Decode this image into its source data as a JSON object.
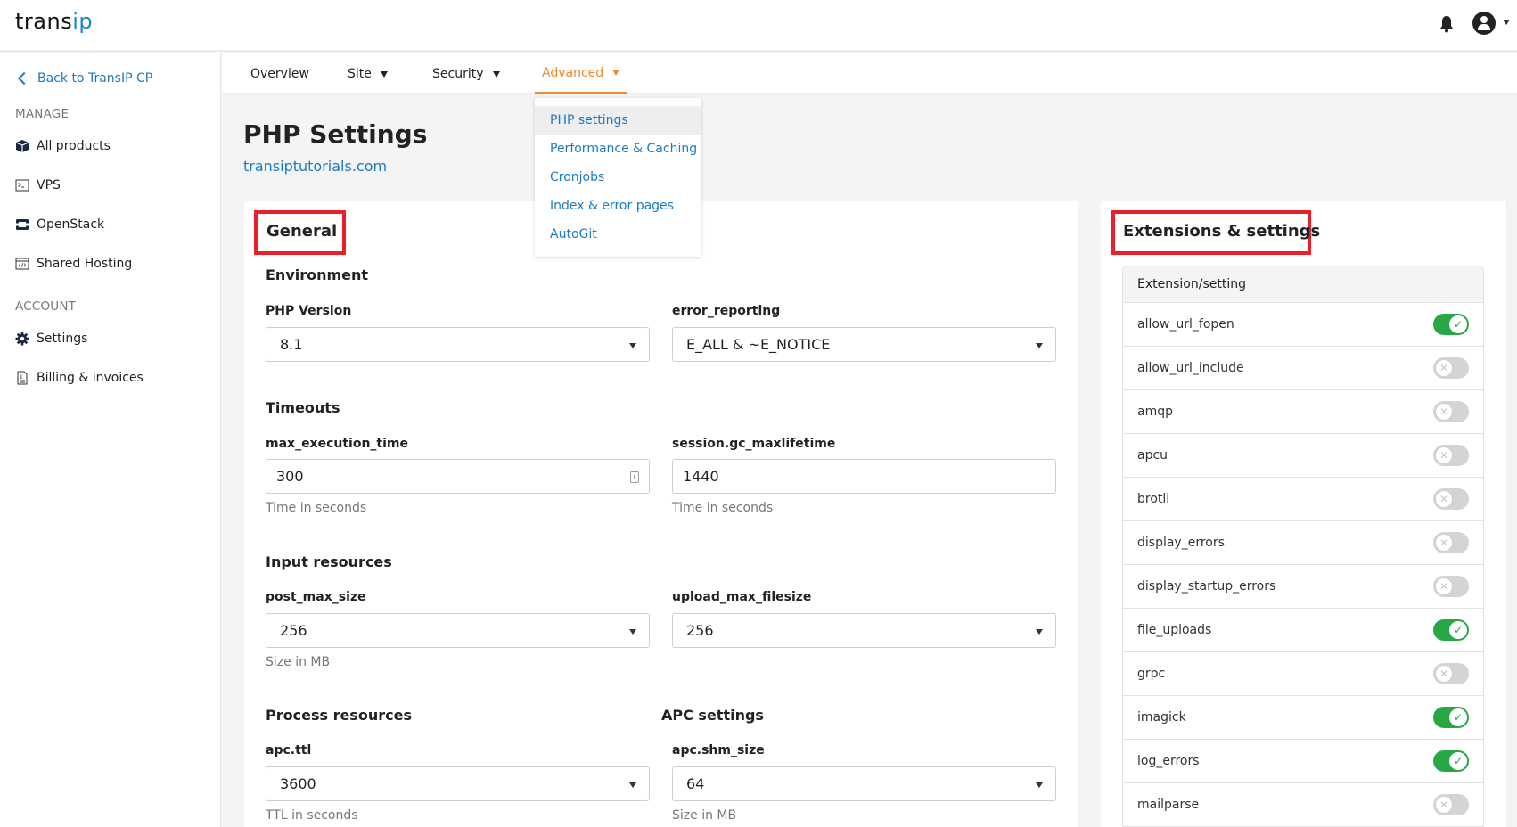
{
  "brand": {
    "name_part1": "trans",
    "name_part2": "ip",
    "accent_color": "#1c86c8"
  },
  "header": {
    "notifications_icon": "bell-icon",
    "user_icon": "user-avatar-icon"
  },
  "sidebar": {
    "back_label": "Back to TransIP CP",
    "manage_label": "MANAGE",
    "manage_items": [
      {
        "label": "All products",
        "icon": "box-icon"
      },
      {
        "label": "VPS",
        "icon": "terminal-icon"
      },
      {
        "label": "OpenStack",
        "icon": "openstack-icon"
      },
      {
        "label": "Shared Hosting",
        "icon": "code-window-icon"
      }
    ],
    "account_label": "ACCOUNT",
    "account_items": [
      {
        "label": "Settings",
        "icon": "gear-icon"
      },
      {
        "label": "Billing & invoices",
        "icon": "invoice-icon"
      }
    ]
  },
  "nav": {
    "tabs": [
      {
        "label": "Overview",
        "has_dropdown": false
      },
      {
        "label": "Site",
        "has_dropdown": true
      },
      {
        "label": "Security",
        "has_dropdown": true
      },
      {
        "label": "Advanced",
        "has_dropdown": true,
        "active": true
      }
    ],
    "active_color": "#f08a2c",
    "advanced_menu": [
      {
        "label": "PHP settings",
        "selected": true
      },
      {
        "label": "Performance & Caching"
      },
      {
        "label": "Cronjobs"
      },
      {
        "label": "Index & error pages"
      },
      {
        "label": "AutoGit"
      }
    ]
  },
  "page": {
    "title": "PHP Settings",
    "domain": "transiptutorials.com"
  },
  "general": {
    "title": "General",
    "environment": {
      "title": "Environment",
      "php_version": {
        "label": "PHP Version",
        "value": "8.1"
      },
      "error_reporting": {
        "label": "error_reporting",
        "value": "E_ALL & ~E_NOTICE"
      }
    },
    "timeouts": {
      "title": "Timeouts",
      "max_execution_time": {
        "label": "max_execution_time",
        "value": "300",
        "help": "Time in seconds"
      },
      "session_gc_maxlifetime": {
        "label": "session.gc_maxlifetime",
        "value": "1440",
        "help": "Time in seconds"
      }
    },
    "input_resources": {
      "title": "Input resources",
      "post_max_size": {
        "label": "post_max_size",
        "value": "256",
        "help": "Size in MB"
      },
      "upload_max_filesize": {
        "label": "upload_max_filesize",
        "value": "256"
      }
    },
    "process_resources": {
      "title": "Process resources",
      "apc_ttl": {
        "label": "apc.ttl",
        "value": "3600",
        "help": "TTL in seconds"
      }
    },
    "apc_settings": {
      "title": "APC settings",
      "apc_shm_size": {
        "label": "apc.shm_size",
        "value": "64",
        "help": "Size in MB"
      }
    }
  },
  "extensions": {
    "title": "Extensions & settings",
    "column_header": "Extension/setting",
    "rows": [
      {
        "name": "allow_url_fopen",
        "enabled": true
      },
      {
        "name": "allow_url_include",
        "enabled": false
      },
      {
        "name": "amqp",
        "enabled": false
      },
      {
        "name": "apcu",
        "enabled": false
      },
      {
        "name": "brotli",
        "enabled": false
      },
      {
        "name": "display_errors",
        "enabled": false
      },
      {
        "name": "display_startup_errors",
        "enabled": false
      },
      {
        "name": "file_uploads",
        "enabled": true
      },
      {
        "name": "grpc",
        "enabled": false
      },
      {
        "name": "imagick",
        "enabled": true
      },
      {
        "name": "log_errors",
        "enabled": true
      },
      {
        "name": "mailparse",
        "enabled": false
      }
    ],
    "on_color": "#27a745",
    "off_color": "#d4d4d4",
    "on_glyph": "✓",
    "off_glyph": "✕"
  },
  "highlight_color": "#e8202a"
}
